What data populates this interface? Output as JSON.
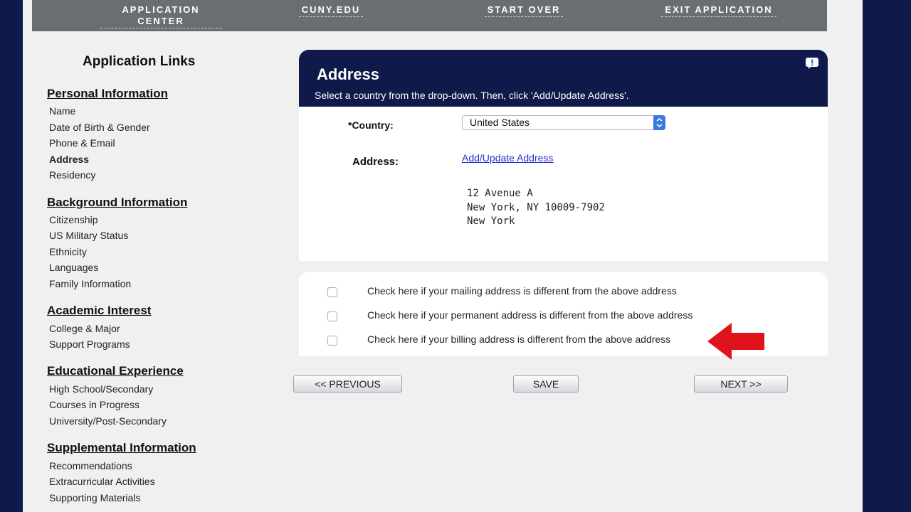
{
  "nav": {
    "items": [
      {
        "label": "APPLICATION CENTER"
      },
      {
        "label": "CUNY.EDU"
      },
      {
        "label": "START OVER"
      },
      {
        "label": "EXIT APPLICATION"
      }
    ]
  },
  "sidebar": {
    "title": "Application Links",
    "sections": [
      {
        "heading": "Personal Information",
        "links": [
          "Name",
          "Date of Birth & Gender",
          "Phone & Email",
          "Address",
          "Residency"
        ]
      },
      {
        "heading": "Background Information",
        "links": [
          "Citizenship",
          "US Military Status",
          "Ethnicity",
          "Languages",
          "Family Information"
        ]
      },
      {
        "heading": "Academic Interest",
        "links": [
          "College & Major",
          "Support Programs"
        ]
      },
      {
        "heading": "Educational Experience",
        "links": [
          "High School/Secondary",
          "Courses in Progress",
          "University/Post-Secondary"
        ]
      },
      {
        "heading": "Supplemental Information",
        "links": [
          "Recommendations",
          "Extracurricular Activities",
          "Supporting Materials"
        ]
      }
    ],
    "active_link": "Address"
  },
  "panel": {
    "title": "Address",
    "subtitle": "Select a country from the drop-down.  Then, click 'Add/Update Address'.",
    "country_label": "*Country:",
    "country_value": "United States",
    "address_label": "Address:",
    "address_link": "Add/Update Address",
    "address_lines": [
      "12 Avenue A",
      "New York, NY 10009-7902",
      "New York"
    ]
  },
  "checkboxes": [
    {
      "label": "Check here if your mailing address is different from the above address",
      "checked": false
    },
    {
      "label": "Check here if your permanent address is different from the above address",
      "checked": false
    },
    {
      "label": "Check here if your billing address is different from the above address",
      "checked": false
    }
  ],
  "buttons": {
    "previous": "<< PREVIOUS",
    "save": "SAVE",
    "next": "NEXT >>"
  },
  "colors": {
    "navy": "#0f1a4a",
    "nav_gray": "#6b6e70",
    "arrow_red": "#e0121c"
  }
}
